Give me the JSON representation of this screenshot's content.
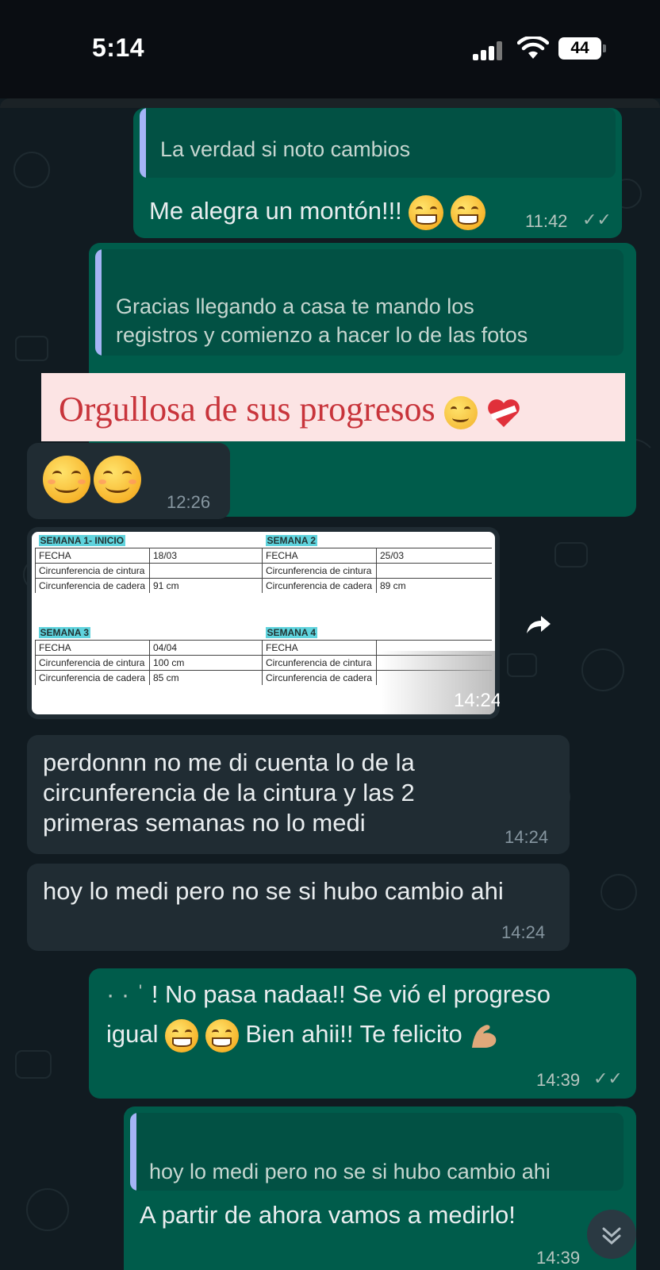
{
  "status_bar": {
    "time": "5:14",
    "battery": "44",
    "signal_icon": "cellular-signal-icon",
    "wifi_icon": "wifi-icon"
  },
  "messages": {
    "m1": {
      "quote": "La verdad si noto cambios",
      "text": "Me alegra un montón!!!",
      "time": "11:42"
    },
    "m2": {
      "quote_line1": "Gracias llegando a casa te mando los",
      "quote_line2": "registros y comienzo a hacer lo de las fotos",
      "banner": "Orgullosa de sus progresos"
    },
    "m3": {
      "time": "12:26"
    },
    "m4": {
      "time": "14:24",
      "sheet": {
        "t1": {
          "title": "SEMANA 1- INICIO",
          "rows": [
            [
              "FECHA",
              "18/03"
            ],
            [
              "Circunferencia de cintura",
              ""
            ],
            [
              "Circunferencia de cadera",
              "91 cm"
            ]
          ]
        },
        "t2": {
          "title": "SEMANA 2",
          "rows": [
            [
              "FECHA",
              "25/03"
            ],
            [
              "Circunferencia de cintura",
              ""
            ],
            [
              "Circunferencia de cadera",
              "89 cm"
            ]
          ]
        },
        "t3": {
          "title": "SEMANA 3",
          "rows": [
            [
              "FECHA",
              "04/04"
            ],
            [
              "Circunferencia de cintura",
              "100 cm"
            ],
            [
              "Circunferencia de cadera",
              "85 cm"
            ]
          ]
        },
        "t4": {
          "title": "SEMANA 4",
          "rows": [
            [
              "FECHA",
              ""
            ],
            [
              "Circunferencia de cintura",
              ""
            ],
            [
              "Circunferencia de cadera",
              ""
            ]
          ]
        }
      }
    },
    "m5": {
      "line1": "perdonnn no me di cuenta lo de la",
      "line2": "circunferencia de la cintura y las 2",
      "line3": "primeras semanas no lo medi",
      "time": "14:24"
    },
    "m6": {
      "text": "hoy lo medi pero no se si hubo cambio ahi",
      "time": "14:24"
    },
    "m7": {
      "line1": "! No pasa nadaa!! Se vió el progreso",
      "line2a": "igual",
      "line2b": "Bien ahii!! Te felicito",
      "time": "14:39"
    },
    "m8": {
      "quote": "hoy lo medi pero no se si hubo cambio ahi",
      "text": "A partir de ahora vamos a medirlo!",
      "time": "14:39"
    }
  },
  "colors": {
    "outgoing": "#005c4b",
    "incoming": "#202c33",
    "background": "#111b21",
    "quote_bar": "#a5b4f6"
  }
}
